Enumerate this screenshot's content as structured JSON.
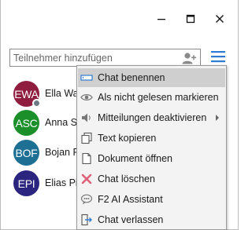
{
  "search": {
    "placeholder": "Teilnehmer hinzufügen"
  },
  "participants": [
    {
      "initials": "EWA",
      "name": "Ella Wag",
      "color": "#8e1d3f",
      "status": true
    },
    {
      "initials": "ASC",
      "name": "Anna Sc",
      "color": "#1a8f2a",
      "status": false
    },
    {
      "initials": "BOF",
      "name": "Bojan Fr",
      "color": "#1d6f94",
      "status": false
    },
    {
      "initials": "EPI",
      "name": "Elias Pic",
      "color": "#2b2580",
      "status": false
    }
  ],
  "menu": {
    "items": [
      {
        "label": "Chat benennen",
        "icon": "rename-icon",
        "highlighted": true
      },
      {
        "label": "Als nicht gelesen markieren",
        "icon": "eye-icon"
      },
      {
        "label": "Mitteilungen deaktivieren",
        "icon": "mute-icon",
        "submenu": true
      },
      {
        "label": "Text kopieren",
        "icon": "copy-icon"
      },
      {
        "label": "Dokument öffnen",
        "icon": "document-icon"
      },
      {
        "label": "Chat löschen",
        "icon": "delete-icon"
      },
      {
        "label": "F2 AI Assistant",
        "icon": "ai-assistant-icon"
      },
      {
        "label": "Chat verlassen",
        "icon": "leave-icon"
      }
    ]
  },
  "colors": {
    "accent": "#1a6fd1",
    "delete": "#e0607a",
    "menu_bg": "#f3f3f3",
    "highlight": "#cfcfcf"
  }
}
